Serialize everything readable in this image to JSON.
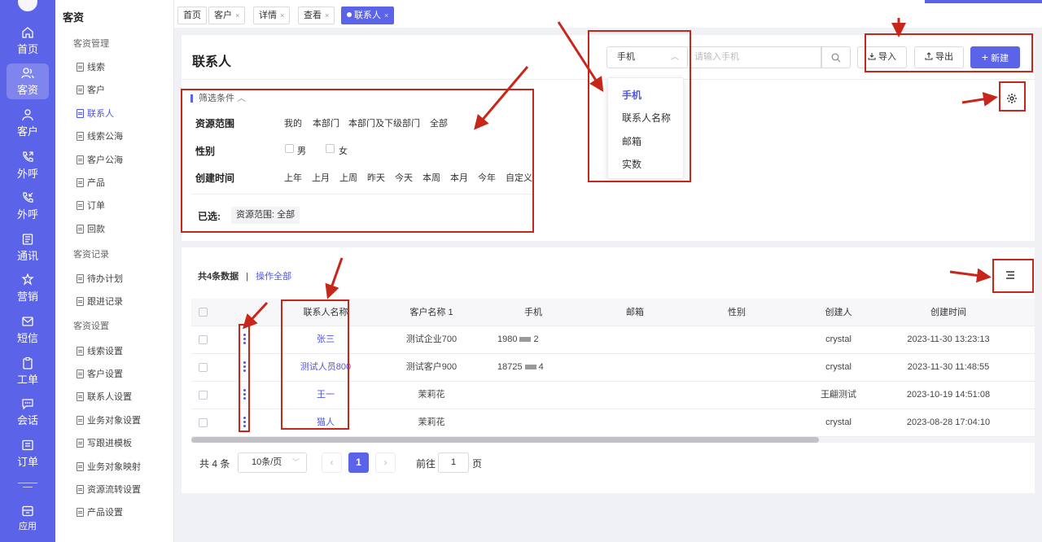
{
  "rail": {
    "items": [
      {
        "label": "首页",
        "icon": "home-icon"
      },
      {
        "label": "客资",
        "icon": "users-icon"
      },
      {
        "label": "客户",
        "icon": "person-icon"
      },
      {
        "label": "外呼",
        "icon": "phone-out-icon"
      },
      {
        "label": "外呼",
        "icon": "phone-callback-icon"
      },
      {
        "label": "通讯",
        "icon": "address-book-icon"
      },
      {
        "label": "营销",
        "icon": "marketing-icon"
      },
      {
        "label": "短信",
        "icon": "sms-icon"
      },
      {
        "label": "工单",
        "icon": "clipboard-icon"
      },
      {
        "label": "会话",
        "icon": "chat-icon"
      },
      {
        "label": "订单",
        "icon": "order-icon"
      },
      {
        "label": "应用",
        "icon": "apps-icon"
      }
    ]
  },
  "submenu": {
    "title": "客资",
    "groups": [
      {
        "label": "客资管理",
        "items": [
          "线索",
          "客户",
          "联系人",
          "线索公海",
          "客户公海",
          "产品",
          "订单",
          "回款"
        ]
      },
      {
        "label": "客资记录",
        "items": [
          "待办计划",
          "跟进记录"
        ]
      },
      {
        "label": "客资设置",
        "items": [
          "线索设置",
          "客户设置",
          "联系人设置",
          "业务对象设置",
          "写跟进模板",
          "业务对象映射",
          "资源流转设置",
          "产品设置"
        ]
      }
    ],
    "active_item": "联系人"
  },
  "tabs": [
    {
      "label": "首页",
      "closable": false
    },
    {
      "label": "客户",
      "closable": true
    },
    {
      "label": "详情",
      "closable": true
    },
    {
      "label": "查看",
      "closable": true
    },
    {
      "label": "联系人",
      "closable": true,
      "active": true
    }
  ],
  "tab_close_glyph": "×",
  "header": {
    "title": "联系人",
    "search": {
      "field_selected": "手机",
      "placeholder": "请输入手机",
      "field_options": [
        "手机",
        "联系人名称",
        "邮箱",
        "实数"
      ]
    },
    "buttons": {
      "import": "导入",
      "export": "导出",
      "new": "新建"
    }
  },
  "filters": {
    "toggle_label": "筛选条件",
    "resource_scope": {
      "label": "资源范围",
      "options": [
        "我的",
        "本部门",
        "本部门及下级部门",
        "全部"
      ]
    },
    "gender": {
      "label": "性别",
      "options": [
        "男",
        "女"
      ]
    },
    "created_time": {
      "label": "创建时间",
      "options": [
        "上年",
        "上月",
        "上周",
        "昨天",
        "今天",
        "本周",
        "本月",
        "今年",
        "自定义"
      ]
    },
    "selected_label": "已选:",
    "selected_chip": "资源范围: 全部"
  },
  "table": {
    "summary_count": "共4条数据",
    "summary_sep": "|",
    "summary_action": "操作全部",
    "columns": [
      "联系人名称",
      "客户名称 1",
      "手机",
      "邮箱",
      "性别",
      "创建人",
      "创建时间"
    ],
    "rows": [
      {
        "name": "张三",
        "customer": "测试企业700",
        "phone_a": "1980",
        "phone_b": "2",
        "email": "",
        "gender": "",
        "creator": "crystal",
        "created": "2023-11-30 13:23:13"
      },
      {
        "name": "测试人员800",
        "customer": "测试客户900",
        "phone_a": "18725",
        "phone_b": "4",
        "email": "",
        "gender": "",
        "creator": "crystal",
        "created": "2023-11-30 11:48:55"
      },
      {
        "name": "王一",
        "customer": "茉莉花",
        "phone_a": "",
        "phone_b": "",
        "email": "",
        "gender": "",
        "creator": "王翩测试",
        "created": "2023-10-19 14:51:08"
      },
      {
        "name": "猫人",
        "customer": "茉莉花",
        "phone_a": "",
        "phone_b": "",
        "email": "",
        "gender": "",
        "creator": "crystal",
        "created": "2023-08-28 17:04:10"
      }
    ]
  },
  "pagination": {
    "total": "共 4 条",
    "page_size": "10条/页",
    "current_page": "1",
    "goto_label": "前往",
    "goto_value": "1",
    "goto_suffix": "页"
  },
  "colors": {
    "accent": "#5b63e8",
    "link": "#4f56e6",
    "annotation": "#c8261a"
  }
}
